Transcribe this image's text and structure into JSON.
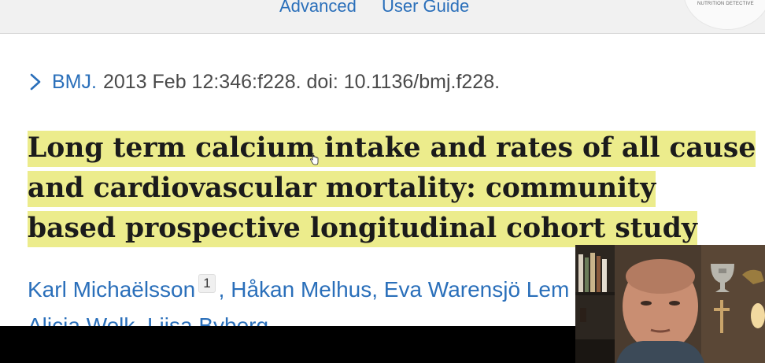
{
  "top_nav": {
    "advanced_label": "Advanced",
    "user_guide_label": "User Guide",
    "logo_text": "NUTRITION DETECTIVE"
  },
  "citation": {
    "journal": "BMJ.",
    "details": "2013 Feb 12:346:f228. doi: 10.1136/bmj.f228."
  },
  "article": {
    "title_lines": [
      "Long term calcium intake and rates of all cause",
      "and cardiovascular mortality: community",
      "based prospective longitudinal cohort study"
    ],
    "highlight_color": "#ecec8c"
  },
  "authors": {
    "first": "Karl Michaëlsson",
    "first_affiliation": "1",
    "second": "Håkan Melhus",
    "third": "Eva Warensjö Lem",
    "line2_first": "Alicja Wolk",
    "line2_second": "Liisa Byberg"
  },
  "colors": {
    "link": "#2a6fba",
    "nav_background": "#f1f1f1",
    "bottom_bar": "#000000"
  },
  "icons": {
    "citation_chevron": "chevron-right-icon",
    "pointer_cursor": "hand-cursor-icon"
  }
}
